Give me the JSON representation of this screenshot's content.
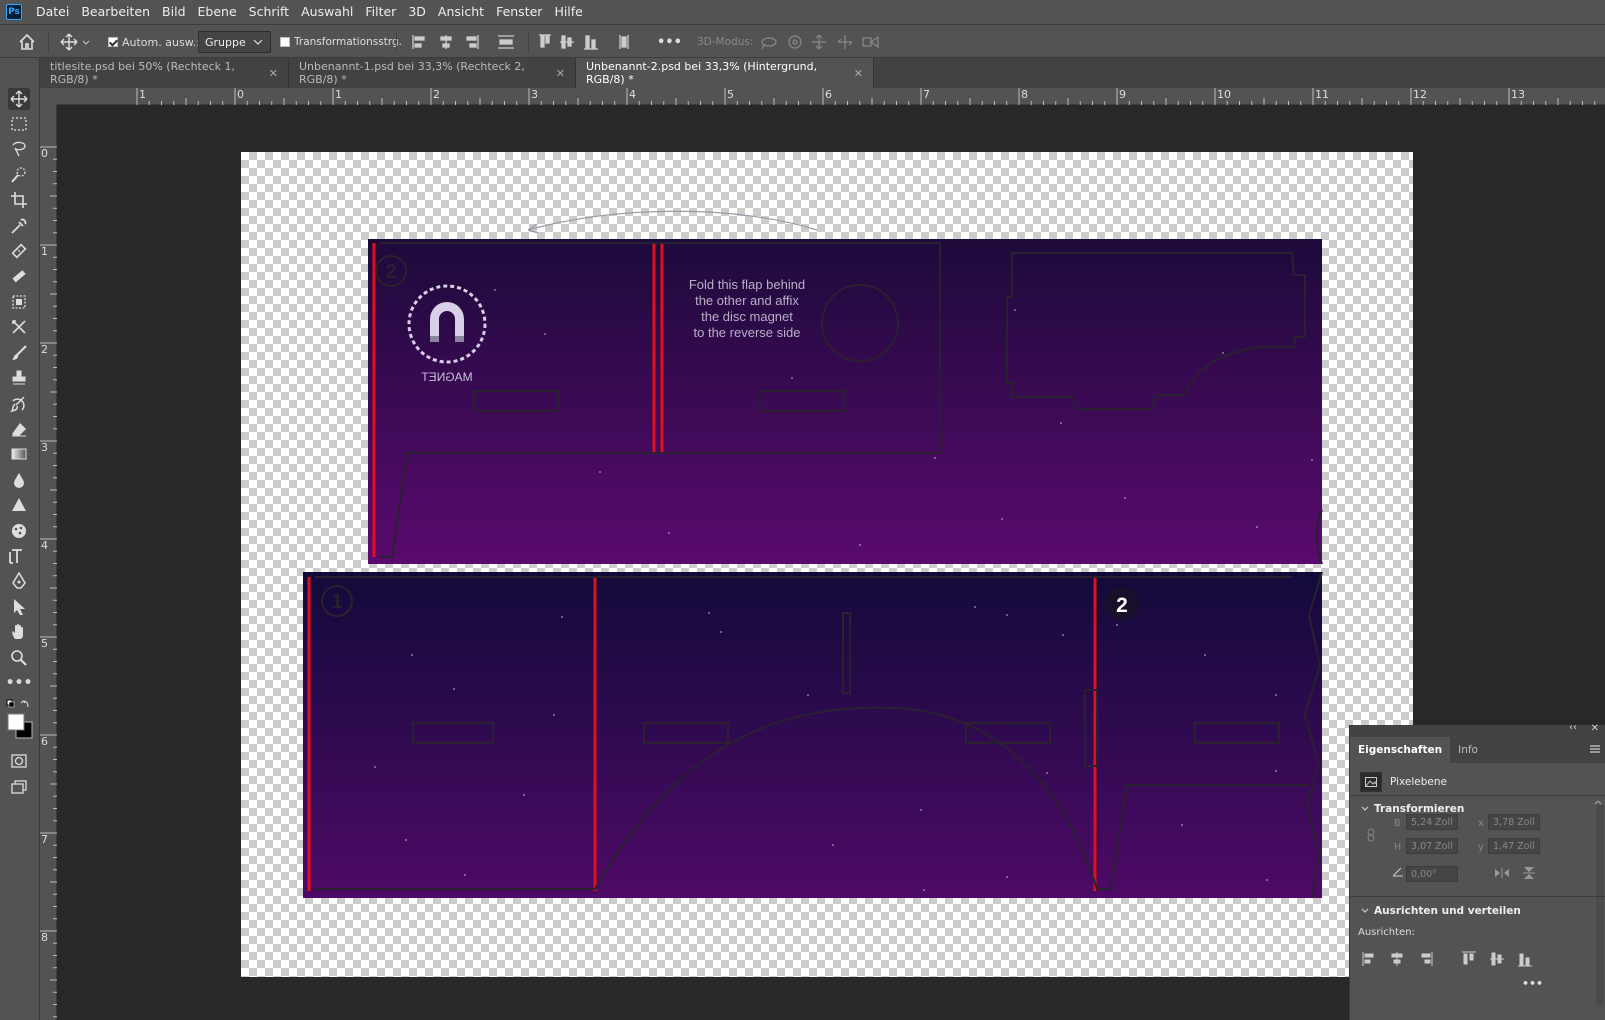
{
  "app": {
    "logo": "Ps"
  },
  "menu": [
    "Datei",
    "Bearbeiten",
    "Bild",
    "Ebene",
    "Schrift",
    "Auswahl",
    "Filter",
    "3D",
    "Ansicht",
    "Fenster",
    "Hilfe"
  ],
  "options": {
    "auto_select_label": "Autom. ausw.:",
    "auto_select_checked": true,
    "group_select": "Gruppe",
    "transform_label": "Transformationsstrg.",
    "transform_checked": false,
    "more_label": "•••",
    "mode3d_label": "3D-Modus:"
  },
  "tabs": [
    {
      "label": "titlesite.psd bei 50% (Rechteck 1, RGB/8) *",
      "active": false
    },
    {
      "label": "Unbenannt-1.psd bei 33,3% (Rechteck 2, RGB/8) *",
      "active": false
    },
    {
      "label": "Unbenannt-2.psd bei 33,3% (Hintergrund, RGB/8) *",
      "active": true
    }
  ],
  "ruler": {
    "top": [
      "1",
      "0",
      "1",
      "2",
      "3",
      "4",
      "5",
      "6",
      "7",
      "8",
      "9",
      "10",
      "11",
      "12",
      "13"
    ],
    "left": [
      "0",
      "1",
      "2",
      "3",
      "4",
      "5",
      "6",
      "7",
      "8"
    ]
  },
  "artwork": {
    "flap_text": [
      "Fold this flap behind",
      "the other and affix",
      "the disc magnet",
      "to the reverse side"
    ],
    "magnet_label": "MAGNET",
    "badge_1": "1",
    "badge_2_outline": "2",
    "badge_2_filled": "2"
  },
  "panel": {
    "tabs": [
      "Eigenschaften",
      "Info"
    ],
    "layer_type": "Pixelebene",
    "transform_section": "Transformieren",
    "w_label": "B",
    "w_value": "5,24 Zoll",
    "h_label": "H",
    "h_value": "3,07 Zoll",
    "x_label": "x",
    "x_value": "3,78 Zoll",
    "y_label": "y",
    "y_value": "1,47 Zoll",
    "angle_value": "0,00°",
    "align_section": "Ausrichten und verteilen",
    "align_label": "Ausrichten:",
    "more": "•••"
  },
  "colors": {
    "accent": "#31a8ff",
    "purple_top": "#1e0a3c",
    "purple_bottom": "#5a0a6e",
    "fold_line": "#e0101e"
  }
}
